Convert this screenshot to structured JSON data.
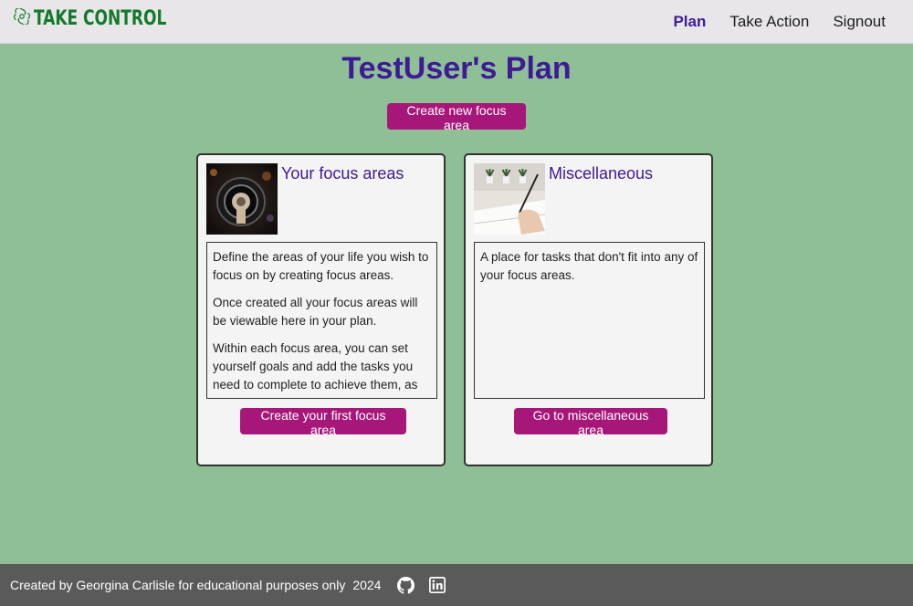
{
  "brand": {
    "name": "TAKE CONTROL",
    "icon": "openai-swirl-icon"
  },
  "nav": {
    "items": [
      {
        "label": "Plan",
        "active": true
      },
      {
        "label": "Take Action",
        "active": false
      },
      {
        "label": "Signout",
        "active": false
      }
    ]
  },
  "page": {
    "title": "TestUser's Plan",
    "create_button": "Create new focus area"
  },
  "cards": [
    {
      "title": "Your focus areas",
      "image": "camera-lens-image",
      "paragraphs": [
        "Define the areas of your life you wish to focus on by creating focus areas.",
        "Once created all your focus areas will be viewable here in your plan.",
        "Within each focus area, you can set yourself goals and add the tasks you need to complete to achieve them, as"
      ],
      "button": "Create your first focus area"
    },
    {
      "title": "Miscellaneous",
      "image": "writing-notebook-image",
      "paragraphs": [
        "A place for tasks that don't fit into any of your focus areas."
      ],
      "button": "Go to miscellaneous area"
    }
  ],
  "footer": {
    "text": "Created by Georgina Carlisle for educational purposes only",
    "year": "2024",
    "icons": [
      "github-icon",
      "linkedin-icon"
    ]
  },
  "colors": {
    "background": "#8fbf95",
    "accent": "#a7177a",
    "title": "#3e1a96",
    "brand": "#137a2c",
    "footer": "#5a5a5a"
  }
}
